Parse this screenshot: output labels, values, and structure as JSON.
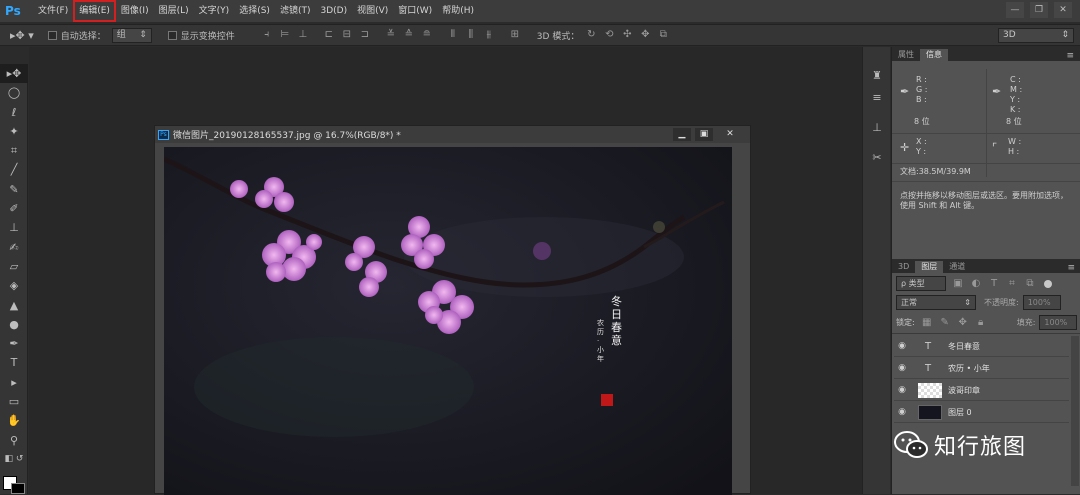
{
  "menubar": {
    "logo": "Ps",
    "items": [
      "文件(F)",
      "编辑(E)",
      "图像(I)",
      "图层(L)",
      "文字(Y)",
      "选择(S)",
      "滤镜(T)",
      "3D(D)",
      "视图(V)",
      "窗口(W)",
      "帮助(H)"
    ],
    "highlight_color": "#d21f1f"
  },
  "window_controls": {
    "minimize": "—",
    "restore": "❐",
    "close": "✕"
  },
  "options_bar": {
    "auto_select_label": "自动选择：",
    "auto_select_value": "组",
    "show_transform_label": "显示变换控件",
    "mode_3d_label": "3D 模式：",
    "workspace_value": "3D"
  },
  "document": {
    "title": "微信图片_20190128165537.jpg @ 16.7%(RGB/8*) *",
    "ps_badge": "Ps",
    "image_poem_title": "冬日春意",
    "image_poem_sub": "农历·小年"
  },
  "info_panel": {
    "tabs": [
      "属性",
      "信息"
    ],
    "active_tab": "信息",
    "rgb_labels": [
      "R :",
      "G :",
      "B :"
    ],
    "cmyk_labels": [
      "C :",
      "M :",
      "Y :",
      "K :"
    ],
    "bits_left": "8 位",
    "bits_right": "8 位",
    "xy_labels": [
      "X :",
      "Y :"
    ],
    "wh_labels": [
      "W :",
      "H :"
    ],
    "doc_size": "文档:38.5M/39.9M",
    "hint": "点按并拖移以移动图层或选区。要用附加选项，使用 Shift 和 Alt 键。"
  },
  "layers_panel": {
    "tabs": [
      "3D",
      "图层",
      "通道"
    ],
    "active_tab": "图层",
    "filter_label": "ρ 类型",
    "blend_mode": "正常",
    "opacity_label": "不透明度:",
    "opacity_value": "100%",
    "lock_label": "锁定:",
    "fill_label": "填充:",
    "fill_value": "100%",
    "layers": [
      {
        "name": "冬日春意",
        "kind": "text"
      },
      {
        "name": "农历 • 小年",
        "kind": "text"
      },
      {
        "name": "波哥印章",
        "kind": "image"
      },
      {
        "name": "图层 0",
        "kind": "photo"
      }
    ]
  },
  "watermark": {
    "text": "知行旅图"
  }
}
